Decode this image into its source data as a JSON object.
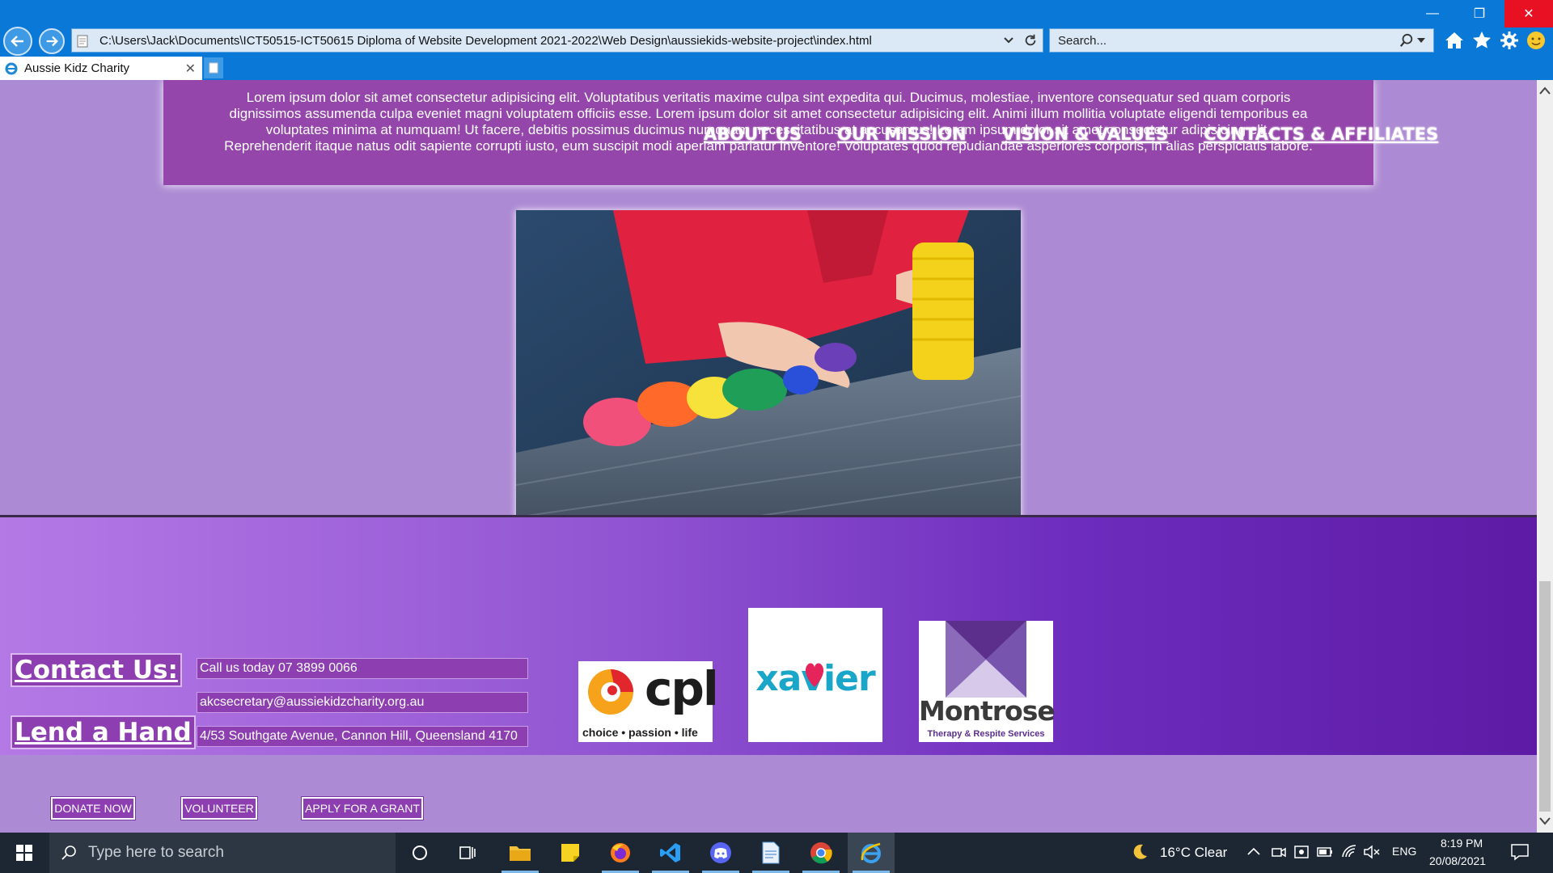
{
  "browser": {
    "address": "C:\\Users\\Jack\\Documents\\ICT50515-ICT50615 Diploma of Website Development 2021-2022\\Web Design\\aussiekids-website-project\\index.html",
    "search_placeholder": "Search...",
    "tab_title": "Aussie Kidz Charity",
    "accent": "#0a78d7"
  },
  "page": {
    "intro_lines": [
      "Lorem ipsum dolor sit amet consectetur adipisicing elit. Voluptatibus veritatis maxime culpa sint expedita qui. Ducimus, molestiae, inventore consequatur sed quam corporis",
      "dignissimos assumenda culpa eveniet magni voluptatem officiis esse. Lorem ipsum dolor sit amet consectetur adipisicing elit. Animi illum mollitia voluptate eligendi temporibus ea",
      "voluptates minima at numquam! Ut facere, debitis possimus ducimus numquam necessitatibus at accusamus! Lorem ipsum dolor sit amet consectetur adipisicing elit.",
      "Reprehenderit itaque natus odit sapiente corrupti iusto, eum suscipit modi aperiam pariatur inventore! Voluptates quod repudiandae asperiores corporis, in alias perspiciatis labore."
    ],
    "nav": [
      "ABOUT US",
      "OUR MISSION",
      "VISION & VALUES",
      "CONTACTS & AFFILIATES"
    ],
    "background": "#ad8bd4",
    "box_color": "#9446aa"
  },
  "footer": {
    "contact_heading": "Contact Us:",
    "lend_heading": "Lend a Hand",
    "phone": "Call us today 07 3899 0066",
    "email": "akcsecretary@aussiekidzcharity.org.au",
    "address": "4/53 Southgate Avenue, Cannon Hill, Queensland 4170",
    "buttons": {
      "donate": "DONATE NOW",
      "volunteer": "VOLUNTEER",
      "grant": "APPLY FOR A GRANT"
    },
    "logos": {
      "cpl": {
        "name": "cpl",
        "tagline": "choice • passion • life"
      },
      "xavier": {
        "name": "xavier"
      },
      "montrose": {
        "name": "Montrose",
        "tagline": "Therapy & Respite Services"
      }
    }
  },
  "taskbar": {
    "search_placeholder": "Type here to search",
    "weather": "16°C  Clear",
    "language": "ENG",
    "time": "8:19 PM",
    "date": "20/08/2021"
  }
}
